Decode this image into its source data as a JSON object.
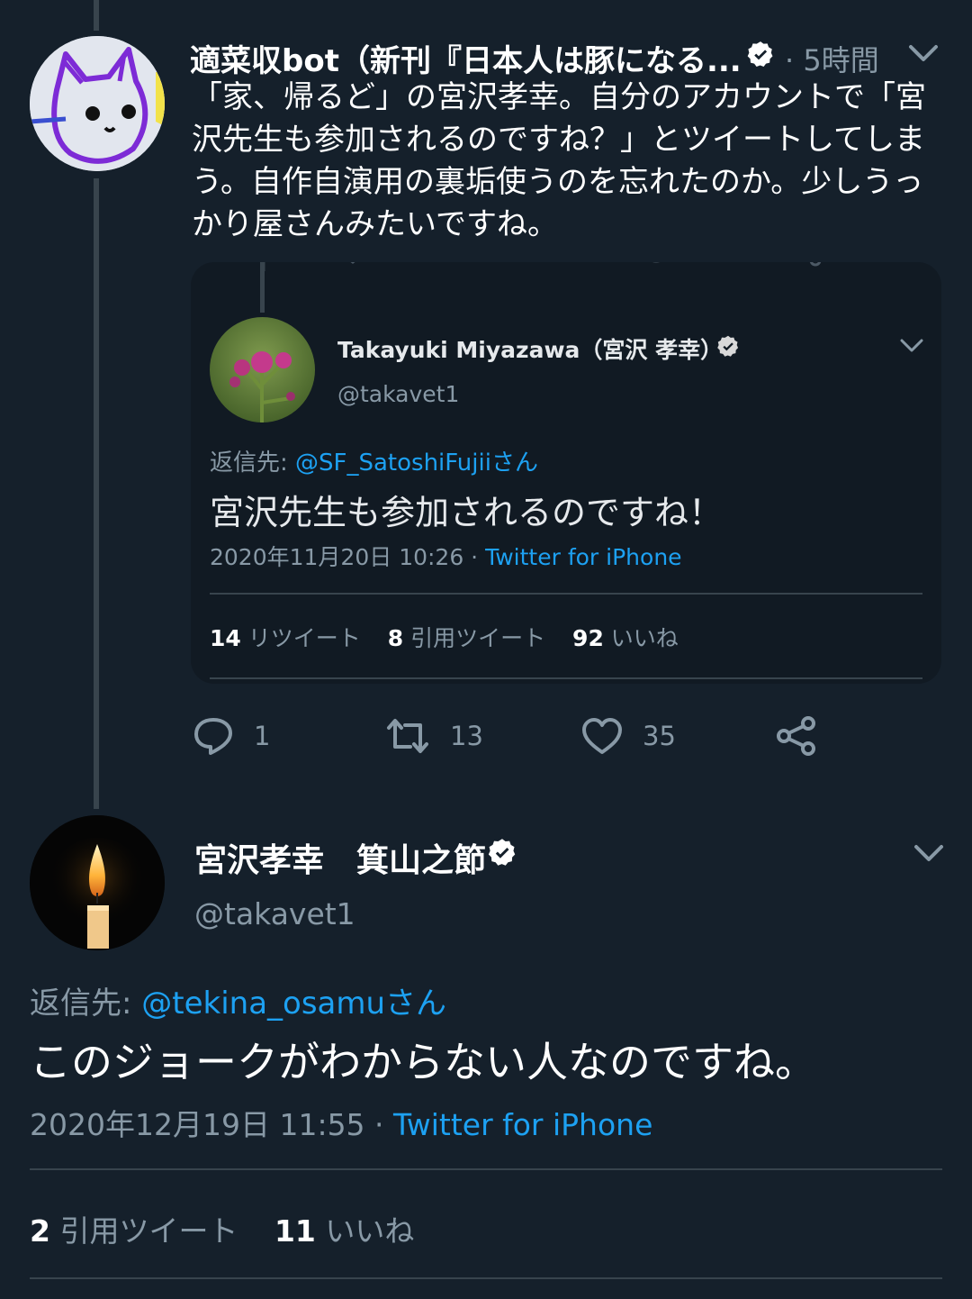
{
  "top_tweet": {
    "display_name": "適菜収bot（新刊『日本人は豚になる...",
    "time": "· 5時間",
    "text": "「家、帰るど」の宮沢孝幸。自分のアカウントで「宮沢先生も参加されるのですね？」とツイートしてしまう。自作自演用の裏垢使うのを忘れたのか。少しうっかり屋さんみたいですね。",
    "avatar_icon": "cat-doodle-avatar",
    "actions": {
      "reply": "1",
      "retweet": "13",
      "like": "35"
    }
  },
  "quoted_tweet": {
    "display_name": "Takayuki Miyazawa（宮沢 孝幸）",
    "handle": "@takavet1",
    "reply_prefix": "返信先: ",
    "reply_to": "@SF_SatoshiFujiiさん",
    "text": "宮沢先生も参加されるのですね！",
    "timestamp": "2020年11月20日 10:26 · ",
    "source": "Twitter for iPhone",
    "stats": {
      "retweets": "14",
      "retweets_label": "リツイート",
      "quotes": "8",
      "quotes_label": "引用ツイート",
      "likes": "92",
      "likes_label": "いいね"
    },
    "avatar_icon": "thistle-flower-avatar"
  },
  "main_tweet": {
    "display_name": "宮沢孝幸　箕山之節",
    "handle": "@takavet1",
    "reply_prefix": "返信先: ",
    "reply_to": "@tekina_osamuさん",
    "text": "このジョークがわからない人なのですね。",
    "timestamp": "2020年12月19日 11:55 · ",
    "source": "Twitter for iPhone",
    "stats": {
      "quotes": "2",
      "quotes_label": "引用ツイート",
      "likes": "11",
      "likes_label": "いいね"
    },
    "avatar_icon": "candle-avatar"
  },
  "colors": {
    "background": "#15202b",
    "card": "#111a23",
    "muted": "#8899a6",
    "link": "#1da1f2",
    "divider": "#38444d"
  }
}
